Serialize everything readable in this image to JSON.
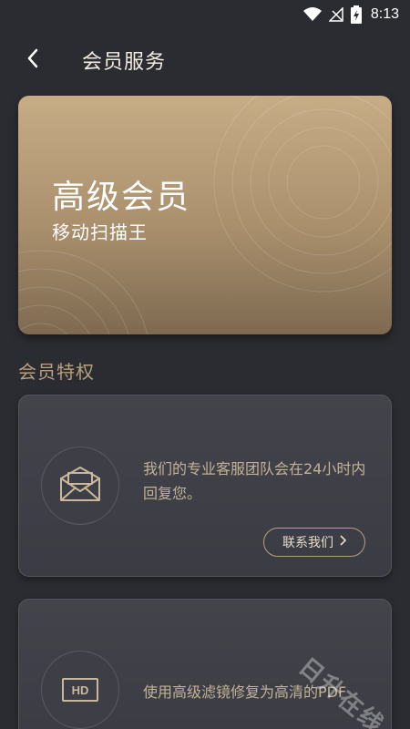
{
  "status_bar": {
    "time": "8:13"
  },
  "header": {
    "title": "会员服务"
  },
  "member_card": {
    "title": "高级会员",
    "subtitle": "移动扫描王"
  },
  "section": {
    "title": "会员特权"
  },
  "features": [
    {
      "icon": "envelope-icon",
      "text": "我们的专业客服团队会在24小时内回复您。",
      "button_label": "联系我们"
    },
    {
      "icon": "hd-icon",
      "icon_label": "HD",
      "text": "使用高级滤镜修复为高清的PDF"
    }
  ],
  "watermark": {
    "text": "日升在线"
  },
  "colors": {
    "background": "#2b2c31",
    "accent": "#b99f7d",
    "card_gold": "#c7ad86"
  }
}
